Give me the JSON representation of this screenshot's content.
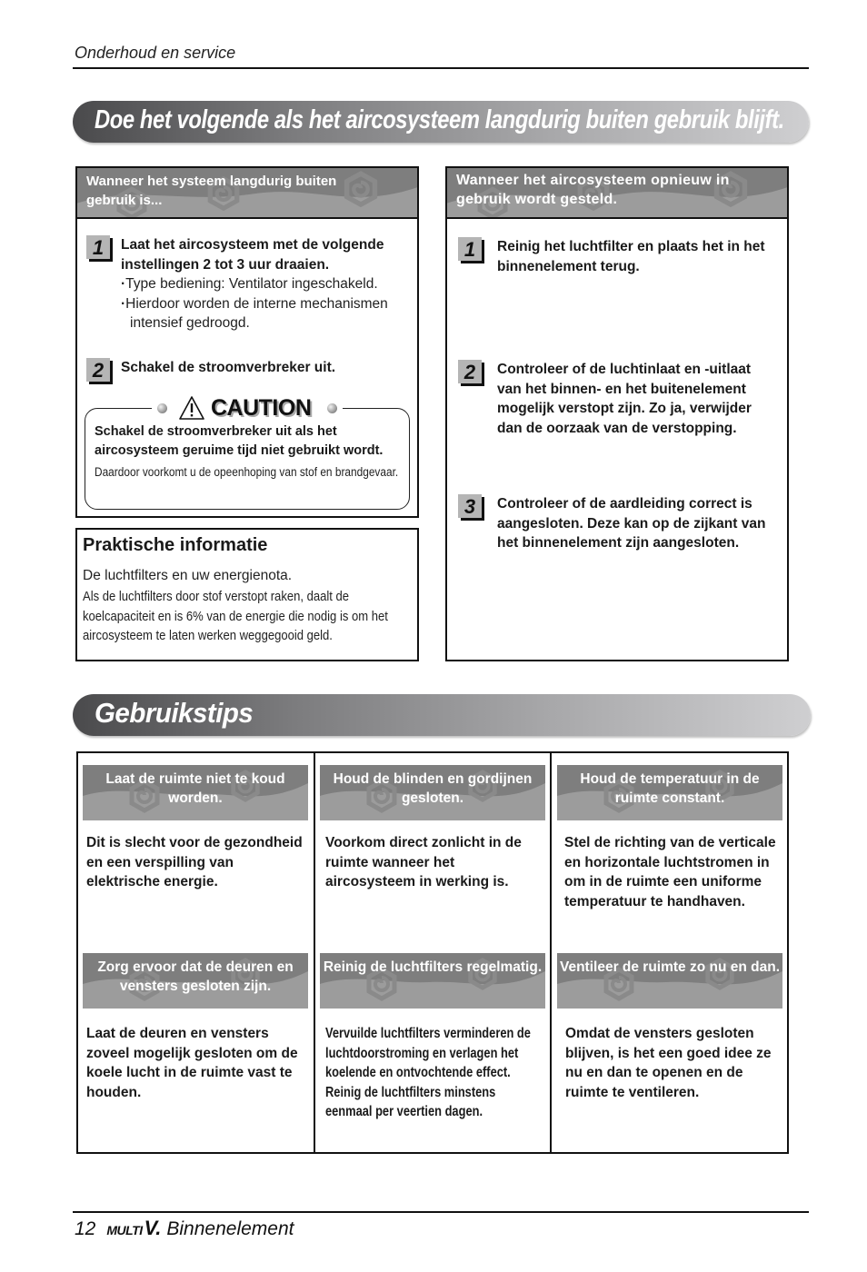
{
  "header": {
    "section_title": "Onderhoud en service"
  },
  "banner_long_term": {
    "title": "Doe het volgende als het aircosysteem langdurig buiten gebruik blijft."
  },
  "panel_not_in_use": {
    "heading": "Wanneer het systeem langdurig buiten gebruik is...",
    "steps": [
      {
        "number": "1",
        "title": "Laat het aircosysteem met de volgende instellingen 2 tot 3 uur draaien.",
        "bullets": [
          "Type bediening: Ventilator ingeschakeld.",
          "Hierdoor worden de interne mechanismen intensief gedroogd."
        ]
      },
      {
        "number": "2",
        "title": "Schakel de stroomverbreker uit."
      }
    ],
    "caution": {
      "icon": "warning-triangle-icon",
      "label": "CAUTION",
      "bold_text": "Schakel de stroomverbreker uit als het aircosysteem geruime tijd niet gebruikt wordt.",
      "note": "Daardoor voorkomt u de opeenhoping van stof en brandgevaar."
    }
  },
  "practical_info": {
    "title": "Praktische informatie",
    "lead": "De luchtfilters en uw energienota.",
    "body": "Als de luchtfilters door stof verstopt raken, daalt de koelcapaciteit en is 6% van de energie die nodig is om het aircosysteem te laten werken weggegooid geld."
  },
  "panel_reuse": {
    "heading": "Wanneer het aircosysteem opnieuw in gebruik wordt gesteld.",
    "steps": [
      {
        "number": "1",
        "title": "Reinig het luchtfilter en plaats het in het binnenelement terug."
      },
      {
        "number": "2",
        "title": "Controleer of de luchtinlaat en -uitlaat van het binnen- en het buitenelement mogelijk verstopt zijn. Zo ja, verwijder dan de oorzaak van de verstopping."
      },
      {
        "number": "3",
        "title": "Controleer of de aardleiding correct is aangesloten. Deze kan op de zijkant van het binnenelement zijn aangesloten."
      }
    ]
  },
  "banner_tips": {
    "title": "Gebruikstips"
  },
  "tips": [
    {
      "heading": "Laat de ruimte niet te koud worden.",
      "body": "Dit is slecht voor de gezondheid en een verspilling van elektrische energie."
    },
    {
      "heading": "Houd de blinden en gordijnen gesloten.",
      "body": "Voorkom direct zonlicht in de ruimte wanneer het aircosysteem in werking is."
    },
    {
      "heading": "Houd de temperatuur in de ruimte constant.",
      "body": "Stel de richting van de verticale en horizontale luchtstromen in om in de ruimte een uniforme temperatuur te handhaven."
    },
    {
      "heading": "Zorg ervoor dat de deuren en vensters gesloten zijn.",
      "body": "Laat de deuren en vensters zoveel mogelijk gesloten om de koele lucht in de ruimte vast te houden."
    },
    {
      "heading": "Reinig de luchtfilters regelmatig.",
      "body": "Vervuilde luchtfilters verminderen de luchtdoorstroming en verlagen het koelende en ontvochtende effect. Reinig de luchtfilters minstens eenmaal per veertien dagen."
    },
    {
      "heading": "Ventileer de ruimte zo nu en dan.",
      "body": "Omdat de vensters gesloten blijven, is het een goed idee ze nu en dan te openen en de ruimte te ventileren."
    }
  ],
  "footer": {
    "page_number": "12",
    "brand": "MULTI",
    "brand_v": "V.",
    "product": "Binnenelement"
  }
}
